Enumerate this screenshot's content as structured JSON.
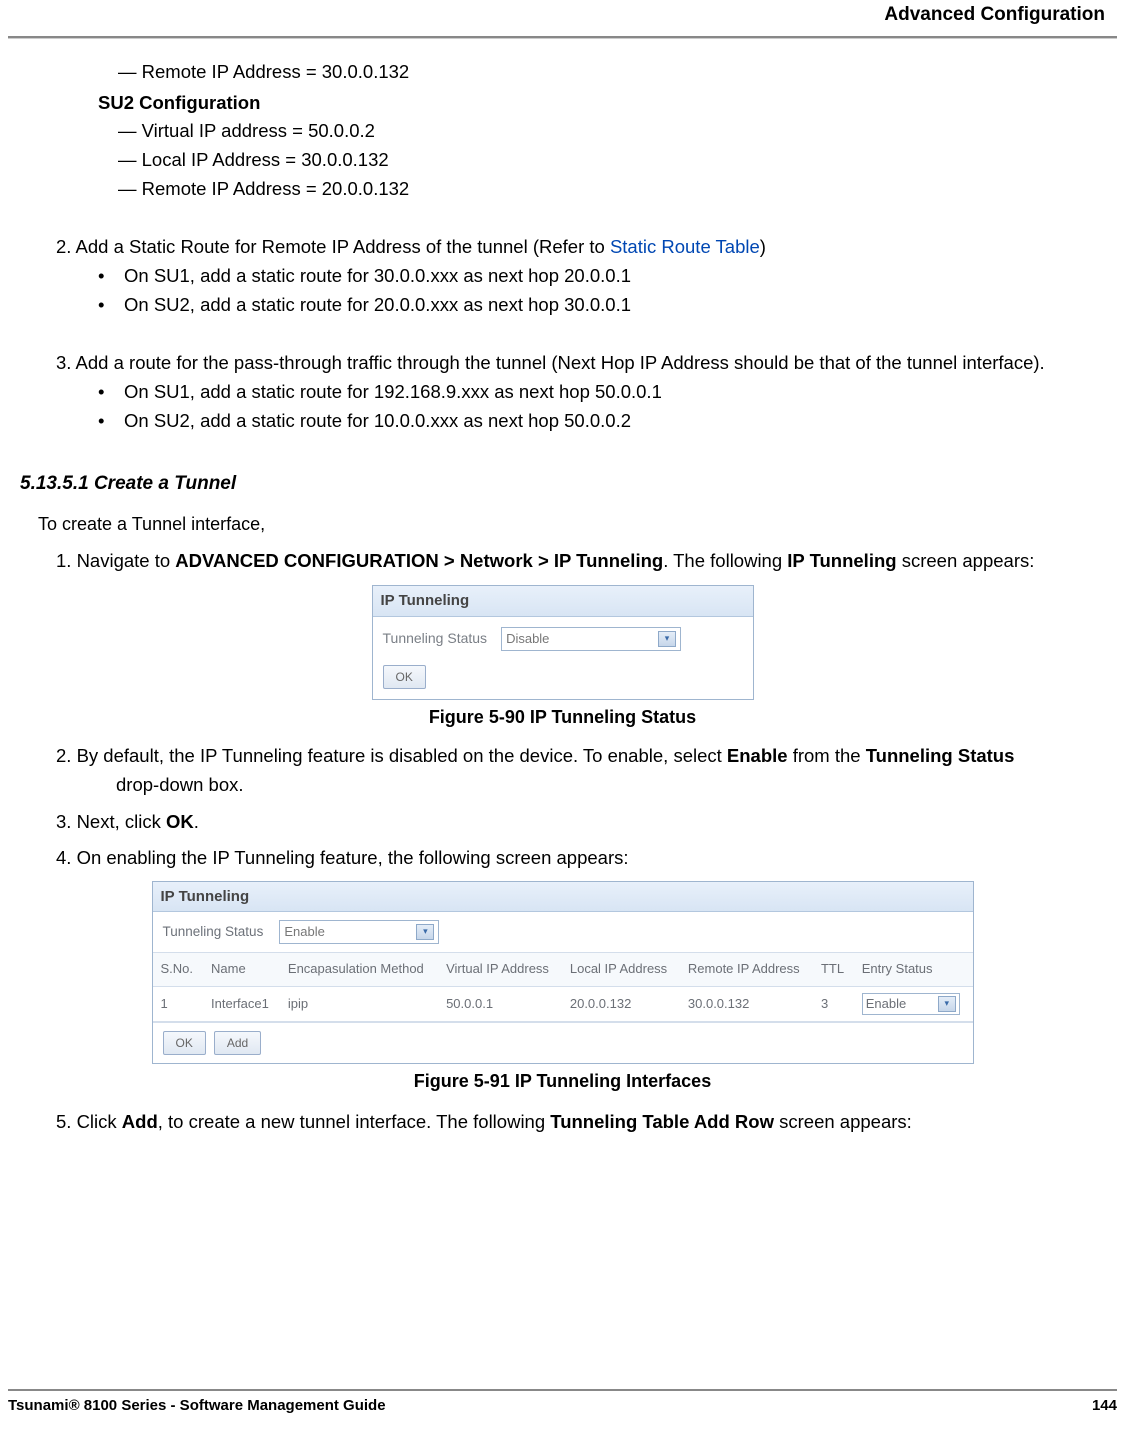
{
  "header": {
    "title": "Advanced Configuration"
  },
  "config": {
    "su1_remote": "Remote IP Address = 30.0.0.132",
    "su2_heading": "SU2 Configuration",
    "su2_virtual": "Virtual IP address = 50.0.0.2",
    "su2_local": "Local IP Address = 30.0.0.132",
    "su2_remote": "Remote IP Address = 20.0.0.132"
  },
  "step2": {
    "lead_a": "2.  Add a Static Route for Remote IP Address of the tunnel (Refer to ",
    "link": "Static Route Table",
    "lead_b": ")",
    "bullet1": "On SU1, add a static route for 30.0.0.xxx as next hop 20.0.0.1",
    "bullet2": "On SU2, add a static route for 20.0.0.xxx as next hop 30.0.0.1"
  },
  "step3": {
    "lead": "3.  Add a route for the pass-through traffic through the tunnel (Next Hop IP Address should be that of the tunnel interface).",
    "bullet1": "On SU1, add a static route for 192.168.9.xxx as next hop 50.0.0.1",
    "bullet2": "On SU2, add a static route for 10.0.0.xxx as next hop 50.0.0.2"
  },
  "section": {
    "number": "5.13.5.1 Create a Tunnel",
    "intro": "To create a Tunnel interface,",
    "s1a": "1.  Navigate to ",
    "s1b": "ADVANCED CONFIGURATION > Network > IP Tunneling",
    "s1c": ". The following ",
    "s1d": "IP Tunneling",
    "s1e": " screen appears:",
    "fig1_panel_title": "IP Tunneling",
    "fig1_label": "Tunneling Status",
    "fig1_value": "Disable",
    "fig1_ok": "OK",
    "fig1_caption": "Figure 5-90 IP Tunneling Status",
    "s2a": "2.  By default, the IP Tunneling feature is disabled on the device. To enable, select ",
    "s2b": "Enable",
    "s2c": " from the ",
    "s2d": "Tunneling Status",
    "s2e": " drop-down box.",
    "s3a": "3.  Next, click ",
    "s3b": "OK",
    "s3c": ".",
    "s4": "4.  On enabling the IP Tunneling feature, the following screen appears:",
    "fig2_panel_title": "IP Tunneling",
    "fig2_status_label": "Tunneling Status",
    "fig2_status_value": "Enable",
    "fig2_headers": {
      "sno": "S.No.",
      "name": "Name",
      "encap": "Encapasulation Method",
      "vip": "Virtual IP Address",
      "lip": "Local IP Address",
      "rip": "Remote IP Address",
      "ttl": "TTL",
      "entry": "Entry Status"
    },
    "fig2_row": {
      "sno": "1",
      "name": "Interface1",
      "encap": "ipip",
      "vip": "50.0.0.1",
      "lip": "20.0.0.132",
      "rip": "30.0.0.132",
      "ttl": "3",
      "entry": "Enable"
    },
    "fig2_ok": "OK",
    "fig2_add": "Add",
    "fig2_caption": "Figure 5-91 IP Tunneling Interfaces",
    "s5a": "5.  Click ",
    "s5b": "Add",
    "s5c": ", to create a new tunnel interface. The following ",
    "s5d": "Tunneling Table Add Row",
    "s5e": " screen appears:"
  },
  "footer": {
    "left": "Tsunami® 8100 Series - Software Management Guide",
    "right": "144"
  }
}
